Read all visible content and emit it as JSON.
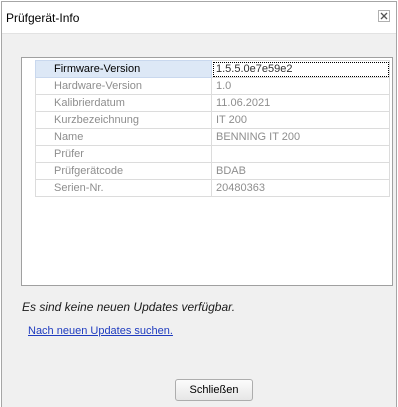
{
  "window": {
    "title": "Prüfgerät-Info"
  },
  "info_table": {
    "rows": [
      {
        "label": "Firmware-Version",
        "value": "1.5.5.0e7e59e2"
      },
      {
        "label": "Hardware-Version",
        "value": "1.0"
      },
      {
        "label": "Kalibrierdatum",
        "value": "11.06.2021"
      },
      {
        "label": "Kurzbezeichnung",
        "value": "IT 200"
      },
      {
        "label": "Name",
        "value": "BENNING IT 200"
      },
      {
        "label": "Prüfer",
        "value": ""
      },
      {
        "label": "Prüfgerätcode",
        "value": "BDAB"
      },
      {
        "label": "Serien-Nr.",
        "value": "20480363"
      }
    ],
    "selected_row": 0
  },
  "status": {
    "message": "Es sind keine neuen Updates verfügbar."
  },
  "check_link": {
    "label": "Nach neuen Updates suchen."
  },
  "close_button": {
    "label": "Schließen"
  },
  "icons": {
    "close": "close-icon"
  },
  "colors": {
    "selection": "#dde8f6",
    "link": "#1f3cbf",
    "grid": "#dcdcdc",
    "muted_text": "#8e8e8e"
  }
}
